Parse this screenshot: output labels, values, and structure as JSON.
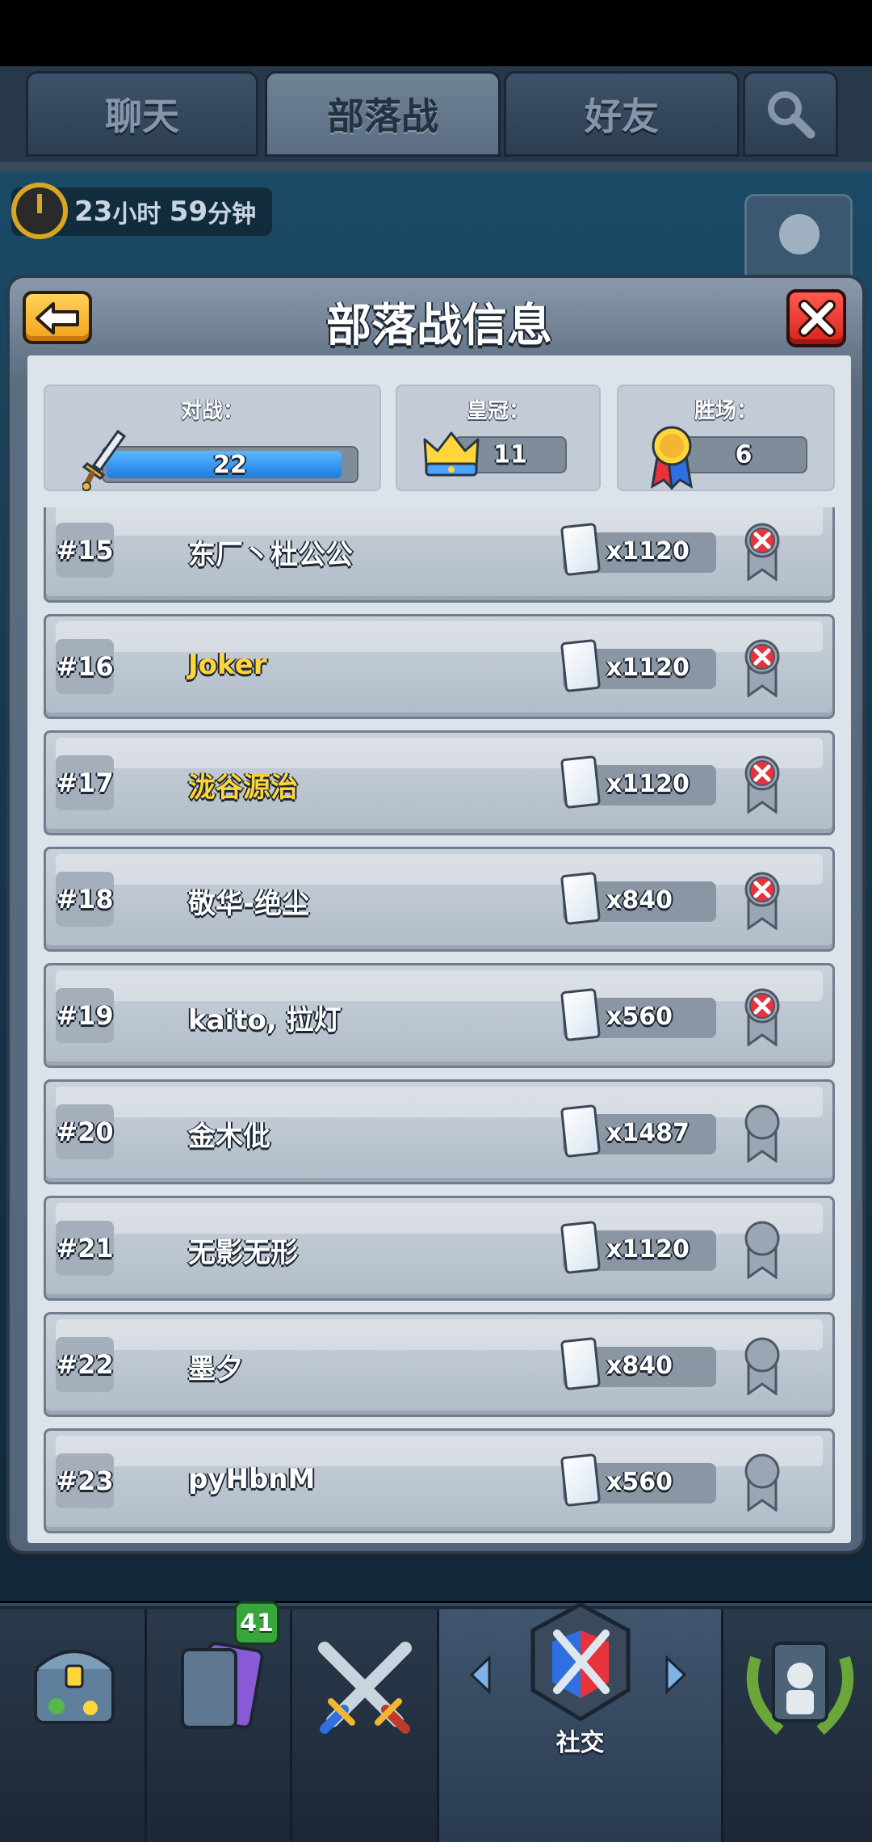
{
  "tabs": [
    {
      "label": "聊天",
      "active": false
    },
    {
      "label": "部落战",
      "active": true
    },
    {
      "label": "好友",
      "active": false
    }
  ],
  "timer": {
    "hours": "23",
    "hours_unit": "小时",
    "minutes": "59",
    "minutes_unit": "分钟"
  },
  "modal": {
    "title": "部落战信息",
    "stats": {
      "battles": {
        "label": "对战：",
        "value": "22",
        "progress": 0.95
      },
      "crowns": {
        "label": "皇冠：",
        "value": "11"
      },
      "wins": {
        "label": "胜场：",
        "value": "6"
      }
    },
    "members": [
      {
        "rank": "#15",
        "name": "东厂丶杜公公",
        "cards": "x1120",
        "status": "lost",
        "highlight": false
      },
      {
        "rank": "#16",
        "name": "Joker",
        "cards": "x1120",
        "status": "lost",
        "highlight": true
      },
      {
        "rank": "#17",
        "name": "泷谷源治",
        "cards": "x1120",
        "status": "lost",
        "highlight": true
      },
      {
        "rank": "#18",
        "name": "敬华-绝尘",
        "cards": "x840",
        "status": "lost",
        "highlight": false
      },
      {
        "rank": "#19",
        "name": "kaito, 拉灯",
        "cards": "x560",
        "status": "lost",
        "highlight": false
      },
      {
        "rank": "#20",
        "name": "金木仳",
        "cards": "x1487",
        "status": "none",
        "highlight": false
      },
      {
        "rank": "#21",
        "name": "无影无形",
        "cards": "x1120",
        "status": "none",
        "highlight": false
      },
      {
        "rank": "#22",
        "name": "墨夕",
        "cards": "x840",
        "status": "none",
        "highlight": false
      },
      {
        "rank": "#23",
        "name": "pyHbnM",
        "cards": "x560",
        "status": "none",
        "highlight": false
      }
    ]
  },
  "bottom_nav": {
    "cards_badge": "41",
    "social_label": "社交"
  },
  "colors": {
    "accent_gold": "#ffd63a",
    "close_red": "#d7231b",
    "back_orange": "#f2a21b",
    "battle_blue": "#1c7be0"
  }
}
